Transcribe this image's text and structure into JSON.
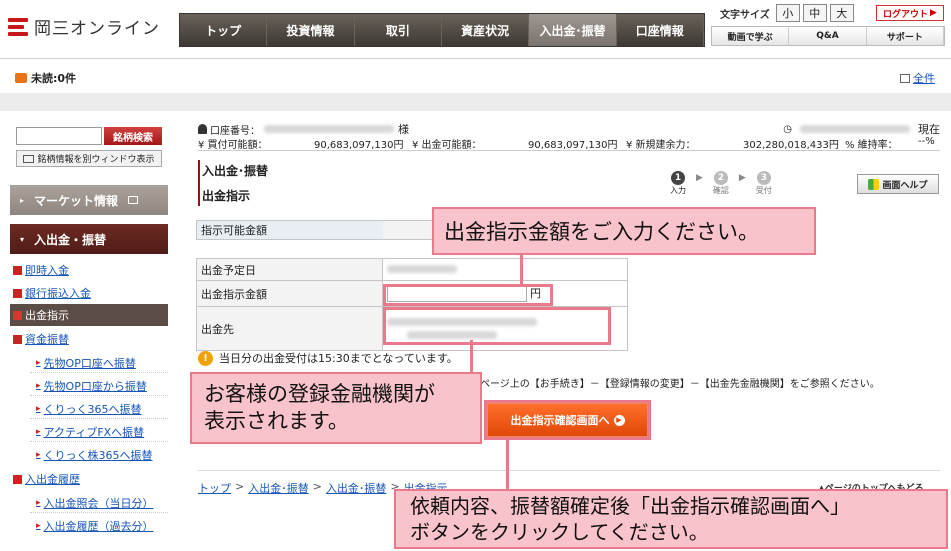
{
  "brand": {
    "logo_text": "岡三オンライン"
  },
  "nav": {
    "tabs": [
      "トップ",
      "投資情報",
      "取引",
      "資産状況",
      "入出金･振替",
      "口座情報"
    ],
    "active_index": 4
  },
  "font_size": {
    "label": "文字サイズ",
    "small": "小",
    "medium": "中",
    "large": "大"
  },
  "logout": "ログアウト",
  "subnav": [
    "動画で学ぶ",
    "Q&A",
    "サポート"
  ],
  "unread": "未読:0件",
  "all_link": "全件",
  "sidebar": {
    "search_button": "銘柄検索",
    "separate_window": "銘柄情報を別ウィンドウ表示",
    "market": "マーケット情報",
    "io_header": "入出金・振替",
    "links": [
      "即時入金",
      "銀行振込入金"
    ],
    "selected": "出金指示",
    "transfer": "資金振替",
    "transfer_subs": [
      "先物OP口座へ振替",
      "先物OP口座から振替",
      "くりっく365へ振替",
      "アクティブFXへ振替",
      "くりっく株365へ振替"
    ],
    "history": "入出金履歴",
    "history_subs": [
      "入出金照会（当日分）",
      "入出金履歴（過去分）"
    ]
  },
  "account": {
    "number_label": "口座番号：",
    "honorific": "様",
    "status": "現在",
    "buy_label": "¥ 買付可能額：",
    "buy_value": "90,683,097,130円",
    "withdraw_label": "¥ 出金可能額：",
    "withdraw_value": "90,683,097,130円",
    "margin_label": "¥ 新規建余力：",
    "margin_value": "302,280,018,433円",
    "ratio_label": "% 維持率：",
    "ratio_value": "--%"
  },
  "page": {
    "title1": "入出金･振替",
    "title2": "出金指示",
    "help": "画面ヘルプ"
  },
  "steps": [
    {
      "n": "1",
      "label": "入力"
    },
    {
      "n": "2",
      "label": "確認"
    },
    {
      "n": "3",
      "label": "受付"
    }
  ],
  "form": {
    "available_label": "指示可能金額",
    "date_label": "出金予定日",
    "amount_label": "出金指示金額",
    "amount_unit": "円",
    "dest_label": "出金先"
  },
  "note": "当日分の出金受付は15:30までとなっています。",
  "note2": "ページ上の【お手続き】－【登録情報の変更】－【出金先金融機関】をご参照ください。",
  "confirm_button": "出金指示確認画面へ",
  "breadcrumb": [
    "トップ",
    "入出金･振替",
    "入出金･振替",
    "出金指示"
  ],
  "pagetop": "ページのトップへもどる",
  "callouts": {
    "c1": "出金指示金額をご入力ください。",
    "c2_line1": "お客様の登録金融機関が",
    "c2_line2": "表示されます。",
    "c3_line1": "依頼内容、振替額確定後「出金指示確認画面へ」",
    "c3_line2": "ボタンをクリックしてください。"
  }
}
